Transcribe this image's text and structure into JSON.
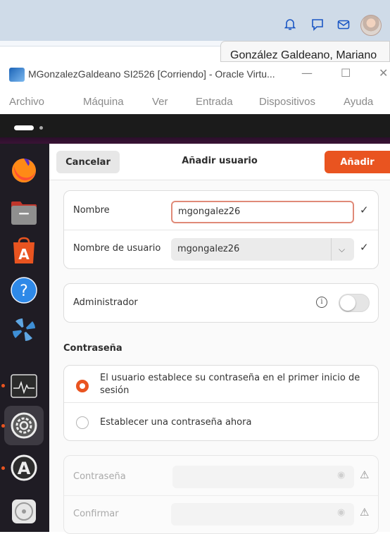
{
  "host": {
    "user_name": "González Galdeano, Mariano",
    "icons": [
      "bell-icon",
      "chat-icon",
      "mail-icon"
    ]
  },
  "vbox": {
    "title": "MGonzalezGaldeano SI2526 [Corriendo] - Oracle Virtu...",
    "menu": [
      "Archivo",
      "Máquina",
      "Ver",
      "Entrada",
      "Dispositivos",
      "Ayuda"
    ]
  },
  "dialog": {
    "cancel_label": "Cancelar",
    "title": "Añadir usuario",
    "add_label": "Añadir",
    "name_label": "Nombre",
    "name_value": "mgongalez26",
    "username_label": "Nombre de usuario",
    "username_value": "mgongalez26",
    "admin_label": "Administrador",
    "admin_enabled": false,
    "password_section": "Contraseña",
    "password_options": [
      {
        "label": "El usuario establece su contraseña en el primer inicio de sesión",
        "selected": true
      },
      {
        "label": "Establecer una contraseña ahora",
        "selected": false
      }
    ],
    "password_label": "Contraseña",
    "confirm_label": "Confirmar"
  },
  "colors": {
    "accent": "#e95420",
    "dock": "#1f1c24",
    "host_bar": "#cfdbe8"
  }
}
